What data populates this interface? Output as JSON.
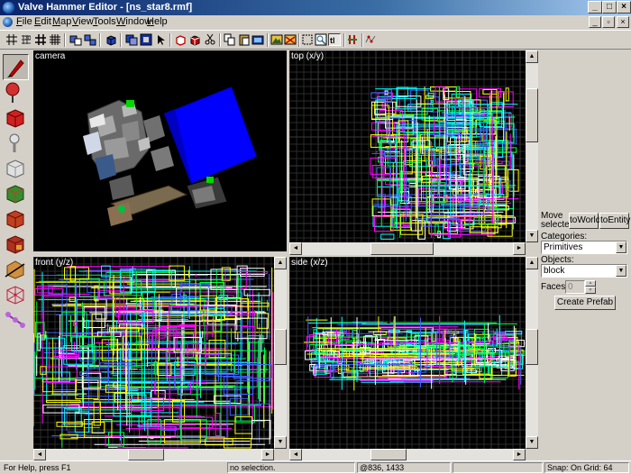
{
  "window": {
    "title": "Valve Hammer Editor - [ns_star8.rmf]"
  },
  "menu": {
    "items": [
      "File",
      "Edit",
      "Map",
      "View",
      "Tools",
      "Window",
      "Help"
    ]
  },
  "viewports": {
    "camera": "camera",
    "top": "top (x/y)",
    "front": "front (y/z)",
    "side": "side (x/z)"
  },
  "panel": {
    "move_selected": "Move selected:",
    "to_world": "toWorld",
    "to_entity": "toEntity",
    "categories_label": "Categories:",
    "categories_value": "Primitives",
    "objects_label": "Objects:",
    "objects_value": "block",
    "faces_label": "Faces:",
    "faces_value": "0",
    "create_prefab": "Create Prefab"
  },
  "status": {
    "help": "For Help, press F1",
    "selection": "no selection.",
    "coords": "@836, 1433",
    "snap": "Snap: On Grid: 64"
  },
  "icons": {
    "toolbar": [
      "grid-icon",
      "3d-grid-icon",
      "large-grid-icon",
      "small-grid-icon",
      "group-icon",
      "ungroup-icon",
      "cube-icon",
      "carve-icon",
      "hollow-icon",
      "select-icon",
      "texture-lock-icon",
      "cut-icon",
      "copy-icon",
      "paste-icon",
      "undo-icon",
      "redo-icon",
      "run-map-icon",
      "texture-browser-icon",
      "texture-apply-icon",
      "options-icon",
      "clip-icon"
    ],
    "tools": [
      "selection-tool-icon",
      "magnify-tool-icon",
      "camera-tool-icon",
      "entity-tool-icon",
      "block-tool-icon",
      "texture-tool-icon",
      "apply-texture-icon",
      "decal-tool-icon",
      "clipping-tool-icon",
      "vertex-tool-icon",
      "path-tool-icon"
    ]
  },
  "colors": {
    "title_bar": "#0a246a",
    "selection_blue": "#0000ff",
    "wire_magenta": "#ff00ff",
    "wire_cyan": "#00ffff",
    "wire_green": "#00ff44",
    "grid": "#3a3a3a"
  }
}
